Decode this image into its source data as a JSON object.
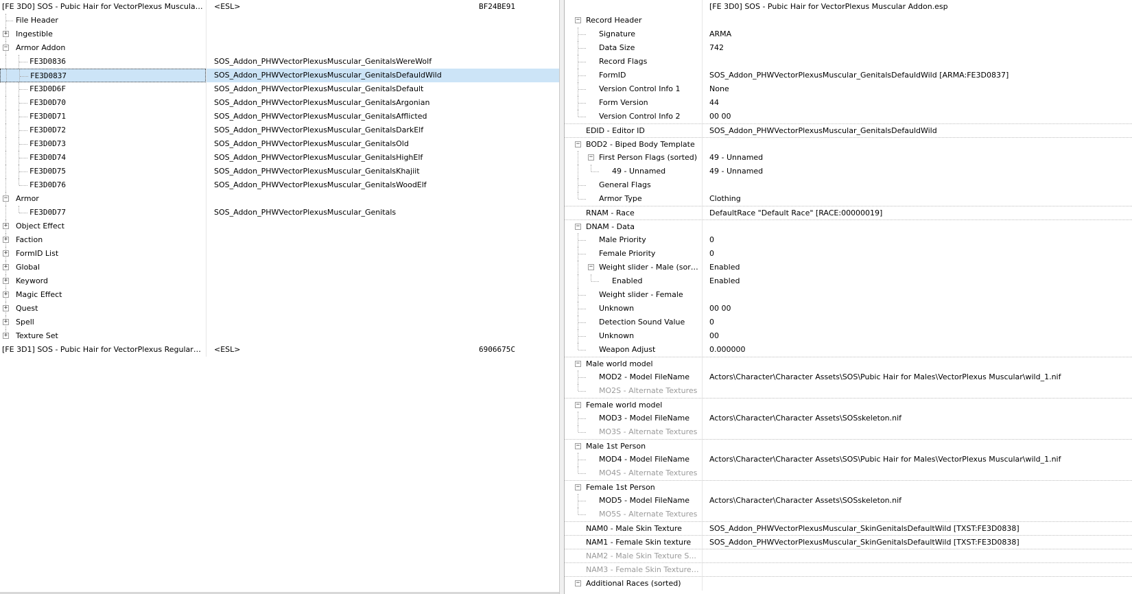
{
  "left_tree": {
    "rows": [
      {
        "name": "[FE 3D0] SOS - Pubic Hair for VectorPlexus Muscular ...",
        "col1": "<ESL>",
        "col2": "BF24BE91",
        "level": 0,
        "toggle": "",
        "mono": false,
        "selected": false
      },
      {
        "name": "File Header",
        "col1": "",
        "col2": "",
        "level": 1,
        "toggle": "",
        "mono": false,
        "selected": false
      },
      {
        "name": "Ingestible",
        "col1": "",
        "col2": "",
        "level": 1,
        "toggle": "+",
        "mono": false,
        "selected": false
      },
      {
        "name": "Armor Addon",
        "col1": "",
        "col2": "",
        "level": 1,
        "toggle": "-",
        "mono": false,
        "selected": false
      },
      {
        "name": "FE3D0836",
        "col1": "SOS_Addon_PHWVectorPlexusMuscular_GenitalsWereWolf",
        "col2": "",
        "level": 2,
        "toggle": "",
        "mono": true,
        "selected": false
      },
      {
        "name": "FE3D0837",
        "col1": "SOS_Addon_PHWVectorPlexusMuscular_GenitalsDefauldWild",
        "col2": "",
        "level": 2,
        "toggle": "",
        "mono": true,
        "selected": true
      },
      {
        "name": "FE3D0D6F",
        "col1": "SOS_Addon_PHWVectorPlexusMuscular_GenitalsDefault",
        "col2": "",
        "level": 2,
        "toggle": "",
        "mono": true,
        "selected": false
      },
      {
        "name": "FE3D0D70",
        "col1": "SOS_Addon_PHWVectorPlexusMuscular_GenitalsArgonian",
        "col2": "",
        "level": 2,
        "toggle": "",
        "mono": true,
        "selected": false
      },
      {
        "name": "FE3D0D71",
        "col1": "SOS_Addon_PHWVectorPlexusMuscular_GenitalsAfflicted",
        "col2": "",
        "level": 2,
        "toggle": "",
        "mono": true,
        "selected": false
      },
      {
        "name": "FE3D0D72",
        "col1": "SOS_Addon_PHWVectorPlexusMuscular_GenitalsDarkElf",
        "col2": "",
        "level": 2,
        "toggle": "",
        "mono": true,
        "selected": false
      },
      {
        "name": "FE3D0D73",
        "col1": "SOS_Addon_PHWVectorPlexusMuscular_GenitalsOld",
        "col2": "",
        "level": 2,
        "toggle": "",
        "mono": true,
        "selected": false
      },
      {
        "name": "FE3D0D74",
        "col1": "SOS_Addon_PHWVectorPlexusMuscular_GenitalsHighElf",
        "col2": "",
        "level": 2,
        "toggle": "",
        "mono": true,
        "selected": false
      },
      {
        "name": "FE3D0D75",
        "col1": "SOS_Addon_PHWVectorPlexusMuscular_GenitalsKhajiit",
        "col2": "",
        "level": 2,
        "toggle": "",
        "mono": true,
        "selected": false
      },
      {
        "name": "FE3D0D76",
        "col1": "SOS_Addon_PHWVectorPlexusMuscular_GenitalsWoodElf",
        "col2": "",
        "level": 2,
        "toggle": "",
        "mono": true,
        "selected": false
      },
      {
        "name": "Armor",
        "col1": "",
        "col2": "",
        "level": 1,
        "toggle": "-",
        "mono": false,
        "selected": false
      },
      {
        "name": "FE3D0D77",
        "col1": "SOS_Addon_PHWVectorPlexusMuscular_Genitals",
        "col2": "",
        "level": 2,
        "toggle": "",
        "mono": true,
        "selected": false
      },
      {
        "name": "Object Effect",
        "col1": "",
        "col2": "",
        "level": 1,
        "toggle": "+",
        "mono": false,
        "selected": false
      },
      {
        "name": "Faction",
        "col1": "",
        "col2": "",
        "level": 1,
        "toggle": "+",
        "mono": false,
        "selected": false
      },
      {
        "name": "FormID List",
        "col1": "",
        "col2": "",
        "level": 1,
        "toggle": "+",
        "mono": false,
        "selected": false
      },
      {
        "name": "Global",
        "col1": "",
        "col2": "",
        "level": 1,
        "toggle": "+",
        "mono": false,
        "selected": false
      },
      {
        "name": "Keyword",
        "col1": "",
        "col2": "",
        "level": 1,
        "toggle": "+",
        "mono": false,
        "selected": false
      },
      {
        "name": "Magic Effect",
        "col1": "",
        "col2": "",
        "level": 1,
        "toggle": "+",
        "mono": false,
        "selected": false
      },
      {
        "name": "Quest",
        "col1": "",
        "col2": "",
        "level": 1,
        "toggle": "+",
        "mono": false,
        "selected": false
      },
      {
        "name": "Spell",
        "col1": "",
        "col2": "",
        "level": 1,
        "toggle": "+",
        "mono": false,
        "selected": false
      },
      {
        "name": "Texture Set",
        "col1": "",
        "col2": "",
        "level": 1,
        "toggle": "+",
        "mono": false,
        "selected": false
      },
      {
        "name": "[FE 3D1] SOS - Pubic Hair for VectorPlexus Regular Ad...",
        "col1": "<ESL>",
        "col2": "6906675C",
        "level": 0,
        "toggle": "",
        "mono": false,
        "selected": false
      }
    ]
  },
  "record_view": {
    "header_value": "[FE 3D0] SOS - Pubic Hair for VectorPlexus Muscular Addon.esp",
    "rows": [
      {
        "label": "Record Header",
        "value": "",
        "level": 0,
        "toggle": "-",
        "dim": false,
        "sep": false
      },
      {
        "label": "Signature",
        "value": "ARMA",
        "level": 1,
        "toggle": "",
        "dim": false,
        "sep": false
      },
      {
        "label": "Data Size",
        "value": "742",
        "level": 1,
        "toggle": "",
        "dim": false,
        "sep": false
      },
      {
        "label": "Record Flags",
        "value": "",
        "level": 1,
        "toggle": "",
        "dim": false,
        "sep": false
      },
      {
        "label": "FormID",
        "value": "SOS_Addon_PHWVectorPlexusMuscular_GenitalsDefauldWild [ARMA:FE3D0837]",
        "level": 1,
        "toggle": "",
        "dim": false,
        "sep": false
      },
      {
        "label": "Version Control Info 1",
        "value": "None",
        "level": 1,
        "toggle": "",
        "dim": false,
        "sep": false
      },
      {
        "label": "Form Version",
        "value": "44",
        "level": 1,
        "toggle": "",
        "dim": false,
        "sep": false
      },
      {
        "label": "Version Control Info 2",
        "value": "00 00",
        "level": 1,
        "toggle": "",
        "dim": false,
        "sep": false
      },
      {
        "label": "EDID - Editor ID",
        "value": "SOS_Addon_PHWVectorPlexusMuscular_GenitalsDefauldWild",
        "level": 0,
        "toggle": "",
        "dim": false,
        "sep": true
      },
      {
        "label": "BOD2 - Biped Body Template",
        "value": "",
        "level": 0,
        "toggle": "-",
        "dim": false,
        "sep": true
      },
      {
        "label": "First Person Flags (sorted)",
        "value": "49 - Unnamed",
        "level": 1,
        "toggle": "-",
        "dim": false,
        "sep": false
      },
      {
        "label": "49 - Unnamed",
        "value": "49 - Unnamed",
        "level": 2,
        "toggle": "",
        "dim": false,
        "sep": false
      },
      {
        "label": "General Flags",
        "value": "",
        "level": 1,
        "toggle": "",
        "dim": false,
        "sep": false
      },
      {
        "label": "Armor Type",
        "value": "Clothing",
        "level": 1,
        "toggle": "",
        "dim": false,
        "sep": false
      },
      {
        "label": "RNAM - Race",
        "value": "DefaultRace \"Default Race\" [RACE:00000019]",
        "level": 0,
        "toggle": "",
        "dim": false,
        "sep": true
      },
      {
        "label": "DNAM - Data",
        "value": "",
        "level": 0,
        "toggle": "-",
        "dim": false,
        "sep": true
      },
      {
        "label": "Male Priority",
        "value": "0",
        "level": 1,
        "toggle": "",
        "dim": false,
        "sep": false
      },
      {
        "label": "Female Priority",
        "value": "0",
        "level": 1,
        "toggle": "",
        "dim": false,
        "sep": false
      },
      {
        "label": "Weight slider - Male (sort...",
        "value": "Enabled",
        "level": 1,
        "toggle": "-",
        "dim": false,
        "sep": false
      },
      {
        "label": "Enabled",
        "value": "Enabled",
        "level": 2,
        "toggle": "",
        "dim": false,
        "sep": false
      },
      {
        "label": "Weight slider - Female",
        "value": "",
        "level": 1,
        "toggle": "",
        "dim": false,
        "sep": false
      },
      {
        "label": "Unknown",
        "value": "00 00",
        "level": 1,
        "toggle": "",
        "dim": false,
        "sep": false
      },
      {
        "label": "Detection Sound Value",
        "value": "0",
        "level": 1,
        "toggle": "",
        "dim": false,
        "sep": false
      },
      {
        "label": "Unknown",
        "value": "00",
        "level": 1,
        "toggle": "",
        "dim": false,
        "sep": false
      },
      {
        "label": "Weapon Adjust",
        "value": "0.000000",
        "level": 1,
        "toggle": "",
        "dim": false,
        "sep": false
      },
      {
        "label": "Male world model",
        "value": "",
        "level": 0,
        "toggle": "-",
        "dim": false,
        "sep": true
      },
      {
        "label": "MOD2 - Model FileName",
        "value": "Actors\\Character\\Character Assets\\SOS\\Pubic Hair for Males\\VectorPlexus Muscular\\wild_1.nif",
        "level": 1,
        "toggle": "",
        "dim": false,
        "sep": false
      },
      {
        "label": "MO2S - Alternate Textures",
        "value": "",
        "level": 1,
        "toggle": "",
        "dim": true,
        "sep": false
      },
      {
        "label": "Female world model",
        "value": "",
        "level": 0,
        "toggle": "-",
        "dim": false,
        "sep": true
      },
      {
        "label": "MOD3 - Model FileName",
        "value": "Actors\\Character\\Character Assets\\SOSskeleton.nif",
        "level": 1,
        "toggle": "",
        "dim": false,
        "sep": false
      },
      {
        "label": "MO3S - Alternate Textures",
        "value": "",
        "level": 1,
        "toggle": "",
        "dim": true,
        "sep": false
      },
      {
        "label": "Male 1st Person",
        "value": "",
        "level": 0,
        "toggle": "-",
        "dim": false,
        "sep": true
      },
      {
        "label": "MOD4 - Model FileName",
        "value": "Actors\\Character\\Character Assets\\SOS\\Pubic Hair for Males\\VectorPlexus Muscular\\wild_1.nif",
        "level": 1,
        "toggle": "",
        "dim": false,
        "sep": false
      },
      {
        "label": "MO4S - Alternate Textures",
        "value": "",
        "level": 1,
        "toggle": "",
        "dim": true,
        "sep": false
      },
      {
        "label": "Female 1st Person",
        "value": "",
        "level": 0,
        "toggle": "-",
        "dim": false,
        "sep": true
      },
      {
        "label": "MOD5 - Model FileName",
        "value": "Actors\\Character\\Character Assets\\SOSskeleton.nif",
        "level": 1,
        "toggle": "",
        "dim": false,
        "sep": false
      },
      {
        "label": "MO5S - Alternate Textures",
        "value": "",
        "level": 1,
        "toggle": "",
        "dim": true,
        "sep": false
      },
      {
        "label": "NAM0 - Male Skin Texture",
        "value": "SOS_Addon_PHWVectorPlexusMuscular_SkinGenitalsDefaultWild [TXST:FE3D0838]",
        "level": 0,
        "toggle": "",
        "dim": false,
        "sep": true
      },
      {
        "label": "NAM1 - Female Skin texture",
        "value": "SOS_Addon_PHWVectorPlexusMuscular_SkinGenitalsDefaultWild [TXST:FE3D0838]",
        "level": 0,
        "toggle": "",
        "dim": false,
        "sep": true
      },
      {
        "label": "NAM2 - Male Skin Texture S...",
        "value": "",
        "level": 0,
        "toggle": "",
        "dim": true,
        "sep": true
      },
      {
        "label": "NAM3 - Female Skin Texture ...",
        "value": "",
        "level": 0,
        "toggle": "",
        "dim": true,
        "sep": true
      },
      {
        "label": "Additional Races (sorted)",
        "value": "",
        "level": 0,
        "toggle": "-",
        "dim": false,
        "sep": true
      }
    ]
  }
}
